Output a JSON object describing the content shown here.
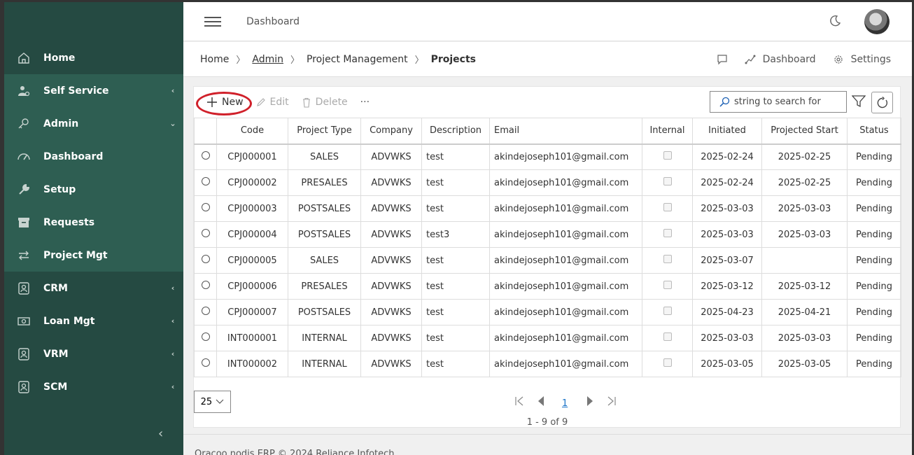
{
  "sidebar": {
    "items": [
      {
        "label": "Home",
        "icon": "home-icon",
        "chevron": ""
      },
      {
        "label": "Self Service",
        "icon": "user-gear-icon",
        "chevron": "‹"
      },
      {
        "label": "Admin",
        "icon": "key-icon",
        "chevron": "⌄"
      },
      {
        "label": "Dashboard",
        "icon": "gauge-icon",
        "chevron": ""
      },
      {
        "label": "Setup",
        "icon": "wrench-icon",
        "chevron": ""
      },
      {
        "label": "Requests",
        "icon": "archive-icon",
        "chevron": ""
      },
      {
        "label": "Project Mgt",
        "icon": "arrows-icon",
        "chevron": ""
      },
      {
        "label": "CRM",
        "icon": "id-badge-icon",
        "chevron": "‹"
      },
      {
        "label": "Loan Mgt",
        "icon": "money-icon",
        "chevron": "‹"
      },
      {
        "label": "VRM",
        "icon": "id-badge-icon",
        "chevron": "‹"
      },
      {
        "label": "SCM",
        "icon": "id-badge-icon",
        "chevron": "‹"
      }
    ],
    "collapse_label": "‹"
  },
  "topbar": {
    "title": "Dashboard"
  },
  "breadcrumb": {
    "home": "Home",
    "admin": "Admin",
    "section": "Project Management",
    "current": "Projects",
    "actions": {
      "dashboard": "Dashboard",
      "settings": "Settings"
    }
  },
  "toolbar": {
    "new": "New",
    "edit": "Edit",
    "delete": "Delete",
    "more": "···",
    "search_placeholder": "string to search for"
  },
  "table": {
    "columns": [
      "Code",
      "Project Type",
      "Company",
      "Description",
      "Email",
      "Internal",
      "Initiated",
      "Projected Start",
      "Status"
    ],
    "rows": [
      [
        "CPJ000001",
        "SALES",
        "ADVWKS",
        "test",
        "akindejoseph101@gmail.com",
        "",
        "2025-02-24",
        "2025-02-25",
        "Pending"
      ],
      [
        "CPJ000002",
        "PRESALES",
        "ADVWKS",
        "test",
        "akindejoseph101@gmail.com",
        "",
        "2025-02-24",
        "2025-02-25",
        "Pending"
      ],
      [
        "CPJ000003",
        "POSTSALES",
        "ADVWKS",
        "test",
        "akindejoseph101@gmail.com",
        "",
        "2025-03-03",
        "2025-03-03",
        "Pending"
      ],
      [
        "CPJ000004",
        "POSTSALES",
        "ADVWKS",
        "test3",
        "akindejoseph101@gmail.com",
        "",
        "2025-03-03",
        "2025-03-03",
        "Pending"
      ],
      [
        "CPJ000005",
        "SALES",
        "ADVWKS",
        "test",
        "akindejoseph101@gmail.com",
        "",
        "2025-03-07",
        "",
        "Pending"
      ],
      [
        "CPJ000006",
        "PRESALES",
        "ADVWKS",
        "test",
        "akindejoseph101@gmail.com",
        "",
        "2025-03-12",
        "2025-03-12",
        "Pending"
      ],
      [
        "CPJ000007",
        "POSTSALES",
        "ADVWKS",
        "test",
        "akindejoseph101@gmail.com",
        "",
        "2025-04-23",
        "2025-04-21",
        "Pending"
      ],
      [
        "INT000001",
        "INTERNAL",
        "ADVWKS",
        "test",
        "akindejoseph101@gmail.com",
        "",
        "2025-03-03",
        "2025-03-03",
        "Pending"
      ],
      [
        "INT000002",
        "INTERNAL",
        "ADVWKS",
        "test",
        "akindejoseph101@gmail.com",
        "",
        "2025-03-05",
        "2025-03-05",
        "Pending"
      ]
    ]
  },
  "pager": {
    "page_size": "25",
    "current_page": "1",
    "info": "1 - 9 of 9"
  },
  "footer": {
    "text": "Oracoo nodis ERP © 2024 Reliance Infotech"
  },
  "colors": {
    "sidebar_bg": "#254a42",
    "sidebar_active": "#2e5e52",
    "highlight_ring": "#d0202a",
    "link": "#1a73c8"
  }
}
